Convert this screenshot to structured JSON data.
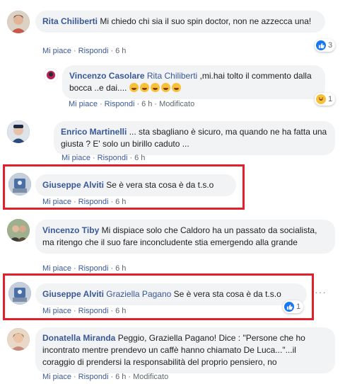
{
  "comments": [
    {
      "author": "Rita Chiliberti",
      "text": "Mi chiedo chi sia il suo spin doctor, non ne azzecca una!",
      "like": "Mi piace",
      "reply": "Rispondi",
      "time": "6 h",
      "reactions": "3",
      "avatar_color": "#c9574a"
    },
    {
      "author": "Vincenzo Casolare",
      "tag": "Rita Chiliberti",
      "text": ",mi.hai tolto il commento dalla bocca ..e dai....",
      "emoji_count": 5,
      "like": "Mi piace",
      "reply": "Rispondi",
      "time": "6 h",
      "edited": "Modificato",
      "reactions": "1",
      "avatar_color": "#b3245a"
    },
    {
      "author": "Enrico Martinelli",
      "text": "... sta sbagliano è sicuro, ma quando ne ha fatta una giusta ? E' solo un birillo caduto ...",
      "like": "Mi piace",
      "reply": "Rispondi",
      "time": "6 h",
      "avatar_color": "#2c4a7a"
    },
    {
      "author": "Giuseppe Alviti",
      "text": "Se è vera sta cosa è da t.s.o",
      "like": "Mi piace",
      "reply": "Rispondi",
      "time": "6 h",
      "avatar_color": "#4a6fa5"
    },
    {
      "author": "Vincenzo Tiby",
      "text": "Mi dispiace solo che Caldoro ha un passato da socialista, ma ritengo che il suo fare inconcludente stia emergendo alla grande",
      "like": "Mi piace",
      "reply": "Rispondi",
      "time": "6 h",
      "avatar_color": "#7a8a6a"
    },
    {
      "author": "Giuseppe Alviti",
      "tag": "Graziella Pagano",
      "text": "Se è vera sta cosa è da t.s.o",
      "like": "Mi piace",
      "reply": "Rispondi",
      "time": "6 h",
      "reactions": "1",
      "avatar_color": "#4a6fa5"
    },
    {
      "author": "Donatella Miranda",
      "text": "Peggio, Graziella Pagano! Dice : \"Persone che ho incontrato mentre prendevo un caffè hanno chiamato De Luca...\"...il coraggio di prendersi la responsabilità del proprio pensiero, no",
      "like": "Mi piace",
      "reply": "Rispondi",
      "time": "6 h",
      "edited": "Modificato",
      "avatar_color": "#c98a7a"
    }
  ],
  "colors": {
    "author": "#385898",
    "bubble": "#f2f3f5",
    "highlight": "#e0202a",
    "like": "#1877f2",
    "haha": "#f7c23a"
  }
}
